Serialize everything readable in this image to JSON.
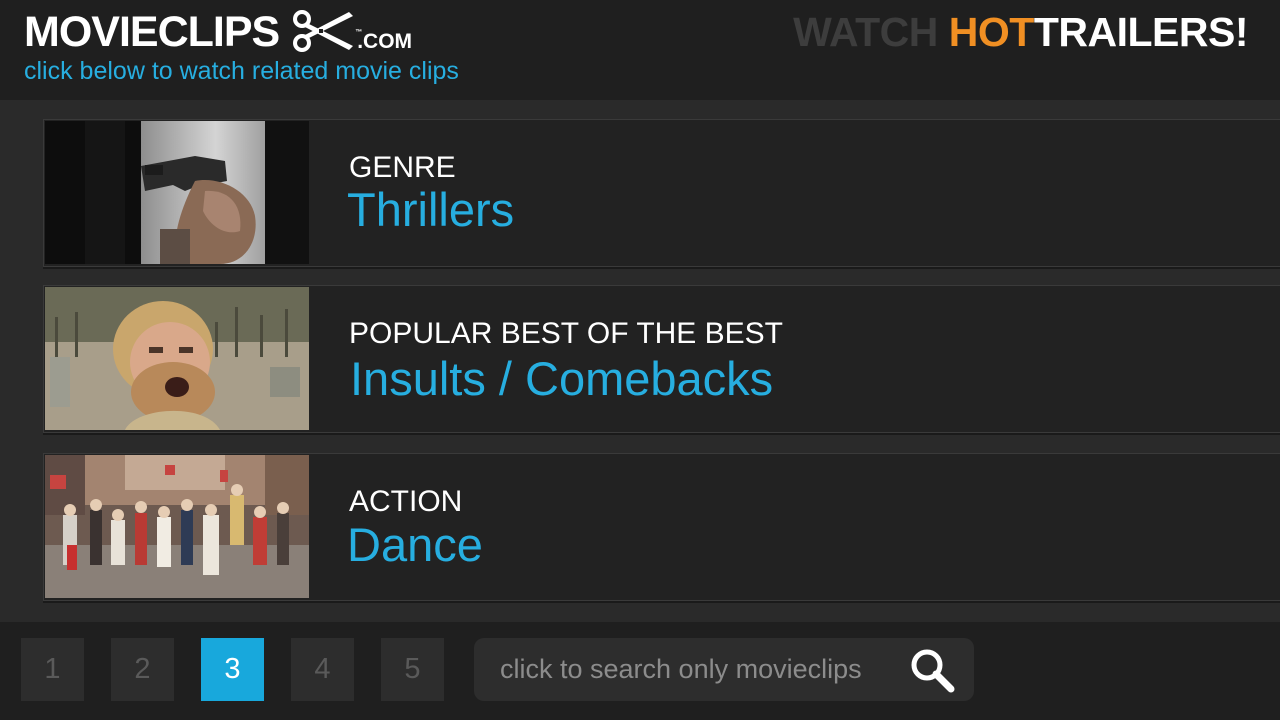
{
  "header": {
    "logo_text": "MOVIECLIPS",
    "logo_suffix": ".COM",
    "logo_tm": "™",
    "subtitle": "click below to watch related movie clips",
    "promo_watch": "WATCH",
    "promo_hot": "HOT",
    "promo_trailers": "TRAILERS!"
  },
  "cards": [
    {
      "category": "GENRE",
      "title": "Thrillers",
      "thumbnail": "handgun-closeup"
    },
    {
      "category": "POPULAR BEST OF THE BEST",
      "title": "Insults / Comebacks",
      "thumbnail": "shouting-bearded-man"
    },
    {
      "category": "ACTION",
      "title": "Dance",
      "thumbnail": "crowd-dancing-street"
    }
  ],
  "pagination": {
    "pages": [
      "1",
      "2",
      "3",
      "4",
      "5"
    ],
    "active": "3"
  },
  "search": {
    "placeholder": "click to search only movieclips",
    "icon": "search-icon"
  },
  "colors": {
    "accent": "#27aee0",
    "hot": "#f08f23",
    "background": "#2a2a2a"
  }
}
